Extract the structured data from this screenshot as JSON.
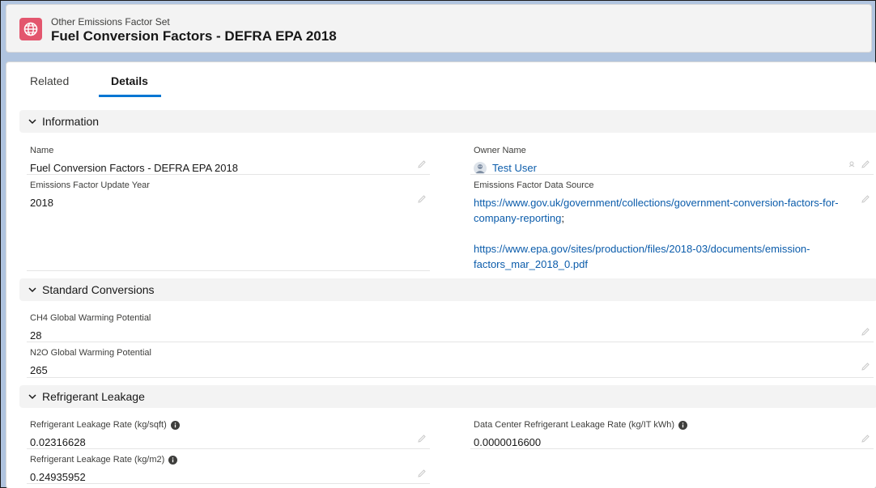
{
  "header": {
    "object_type": "Other Emissions Factor Set",
    "record_title": "Fuel Conversion Factors - DEFRA EPA 2018",
    "icon": "globe-icon",
    "icon_color": "#e3566e"
  },
  "tabs": [
    {
      "label": "Related",
      "active": false
    },
    {
      "label": "Details",
      "active": true
    }
  ],
  "sections": {
    "information": {
      "title": "Information",
      "fields": {
        "name": {
          "label": "Name",
          "value": "Fuel Conversion Factors - DEFRA EPA 2018"
        },
        "owner": {
          "label": "Owner Name",
          "value": "Test User"
        },
        "update_year": {
          "label": "Emissions Factor Update Year",
          "value": "2018"
        },
        "data_source": {
          "label": "Emissions Factor Data Source",
          "link1_line1": "https://www.gov.uk/government/collections/government-conversion-factors-for-",
          "link1_line2": "company-reporting",
          "separator": ";",
          "link2_line1": "https://www.epa.gov/sites/production/files/2018-03/documents/emission-",
          "link2_line2": "factors_mar_2018_0.pdf"
        }
      }
    },
    "standard_conversions": {
      "title": "Standard Conversions",
      "fields": {
        "ch4": {
          "label": "CH4 Global Warming Potential",
          "value": "28"
        },
        "n2o": {
          "label": "N2O Global Warming Potential",
          "value": "265"
        }
      }
    },
    "refrigerant_leakage": {
      "title": "Refrigerant Leakage",
      "fields": {
        "rate_sqft": {
          "label": "Refrigerant Leakage Rate (kg/sqft)",
          "value": "0.02316628"
        },
        "dc_rate": {
          "label": "Data Center Refrigerant Leakage Rate (kg/IT kWh)",
          "value": "0.0000016600"
        },
        "rate_m2": {
          "label": "Refrigerant Leakage Rate (kg/m2)",
          "value": "0.24935952"
        }
      }
    }
  },
  "colors": {
    "accent": "#0176d3",
    "link": "#0b5cab",
    "background": "#b0c4df"
  }
}
